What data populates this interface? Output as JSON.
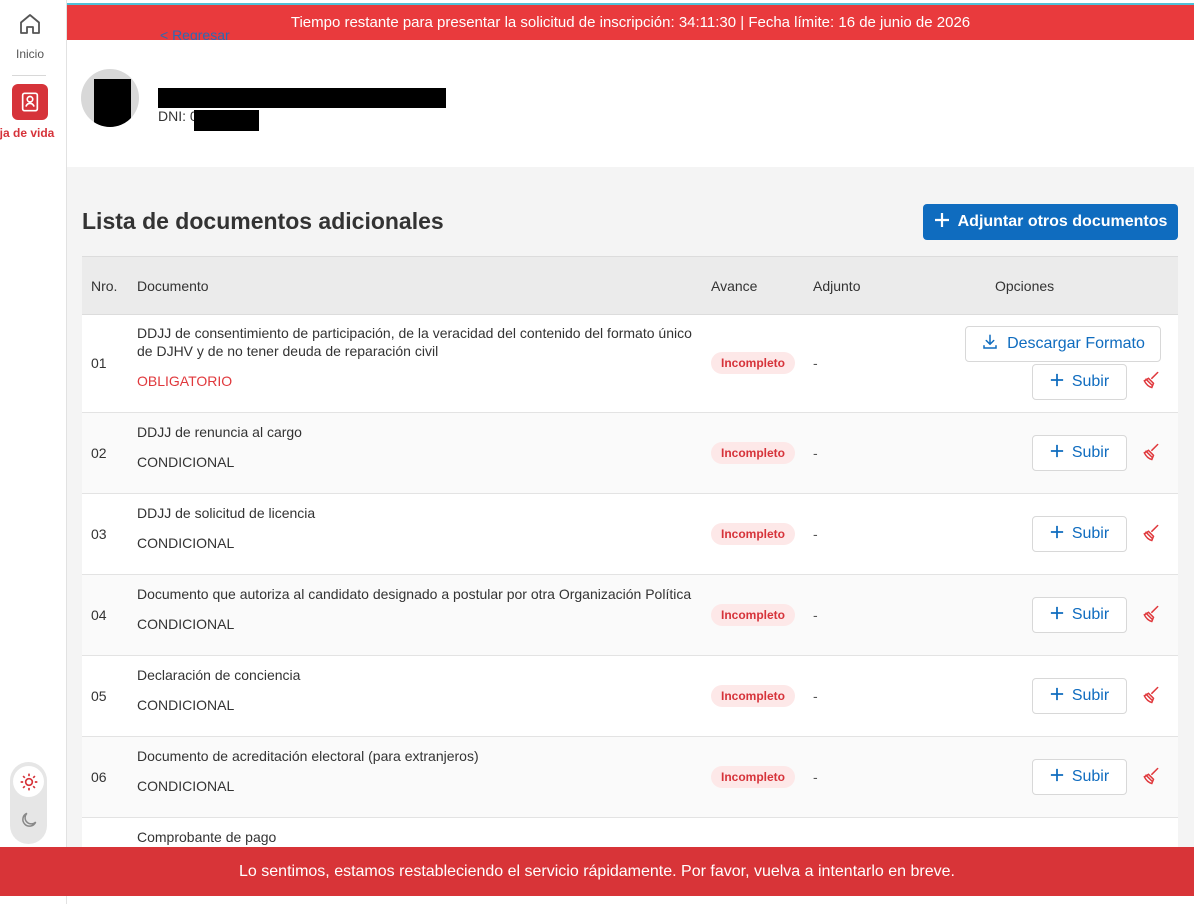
{
  "sidebar": {
    "home_label": "Inicio",
    "hoja_label": "Hoja de vida"
  },
  "top_alert": "Tiempo restante para presentar la solicitud de inscripción: 34:11:30 | Fecha límite: 16 de junio de 2026",
  "back_link": "< Regresar",
  "profile": {
    "dni_label": "DNI: 0"
  },
  "list": {
    "title": "Lista de documentos adicionales",
    "attach_label": "Adjuntar otros documentos",
    "headers": {
      "nro": "Nro.",
      "documento": "Documento",
      "avance": "Avance",
      "adjunto": "Adjunto",
      "opciones": "Opciones"
    },
    "download_label": "Descargar Formato",
    "upload_label": "Subir",
    "rows": [
      {
        "nro": "01",
        "doc": "DDJJ de consentimiento de participación, de la veracidad del contenido del formato único de DJHV y de no tener deuda de reparación civil",
        "req": "OBLIGATORIO",
        "status": "Incompleto",
        "adjunto": "-"
      },
      {
        "nro": "02",
        "doc": "DDJJ de renuncia al cargo",
        "req": "CONDICIONAL",
        "status": "Incompleto",
        "adjunto": "-"
      },
      {
        "nro": "03",
        "doc": "DDJJ de solicitud de licencia",
        "req": "CONDICIONAL",
        "status": "Incompleto",
        "adjunto": "-"
      },
      {
        "nro": "04",
        "doc": "Documento que autoriza al candidato designado a postular por otra Organización Política",
        "req": "CONDICIONAL",
        "status": "Incompleto",
        "adjunto": "-"
      },
      {
        "nro": "05",
        "doc": "Declaración de conciencia",
        "req": "CONDICIONAL",
        "status": "Incompleto",
        "adjunto": "-"
      },
      {
        "nro": "06",
        "doc": "Documento de acreditación electoral (para extranjeros)",
        "req": "CONDICIONAL",
        "status": "Incompleto",
        "adjunto": "-"
      },
      {
        "nro": "",
        "doc": "Comprobante de pago",
        "req": "",
        "status": "",
        "adjunto": ""
      }
    ]
  },
  "bottom_alert": "Lo sentimos, estamos restableciendo el servicio rápidamente. Por favor, vuelva a intentarlo en breve.",
  "colors": {
    "brand_red": "#d6333a",
    "brand_blue": "#0f6cbf",
    "alert_red": "#e93a3d"
  }
}
